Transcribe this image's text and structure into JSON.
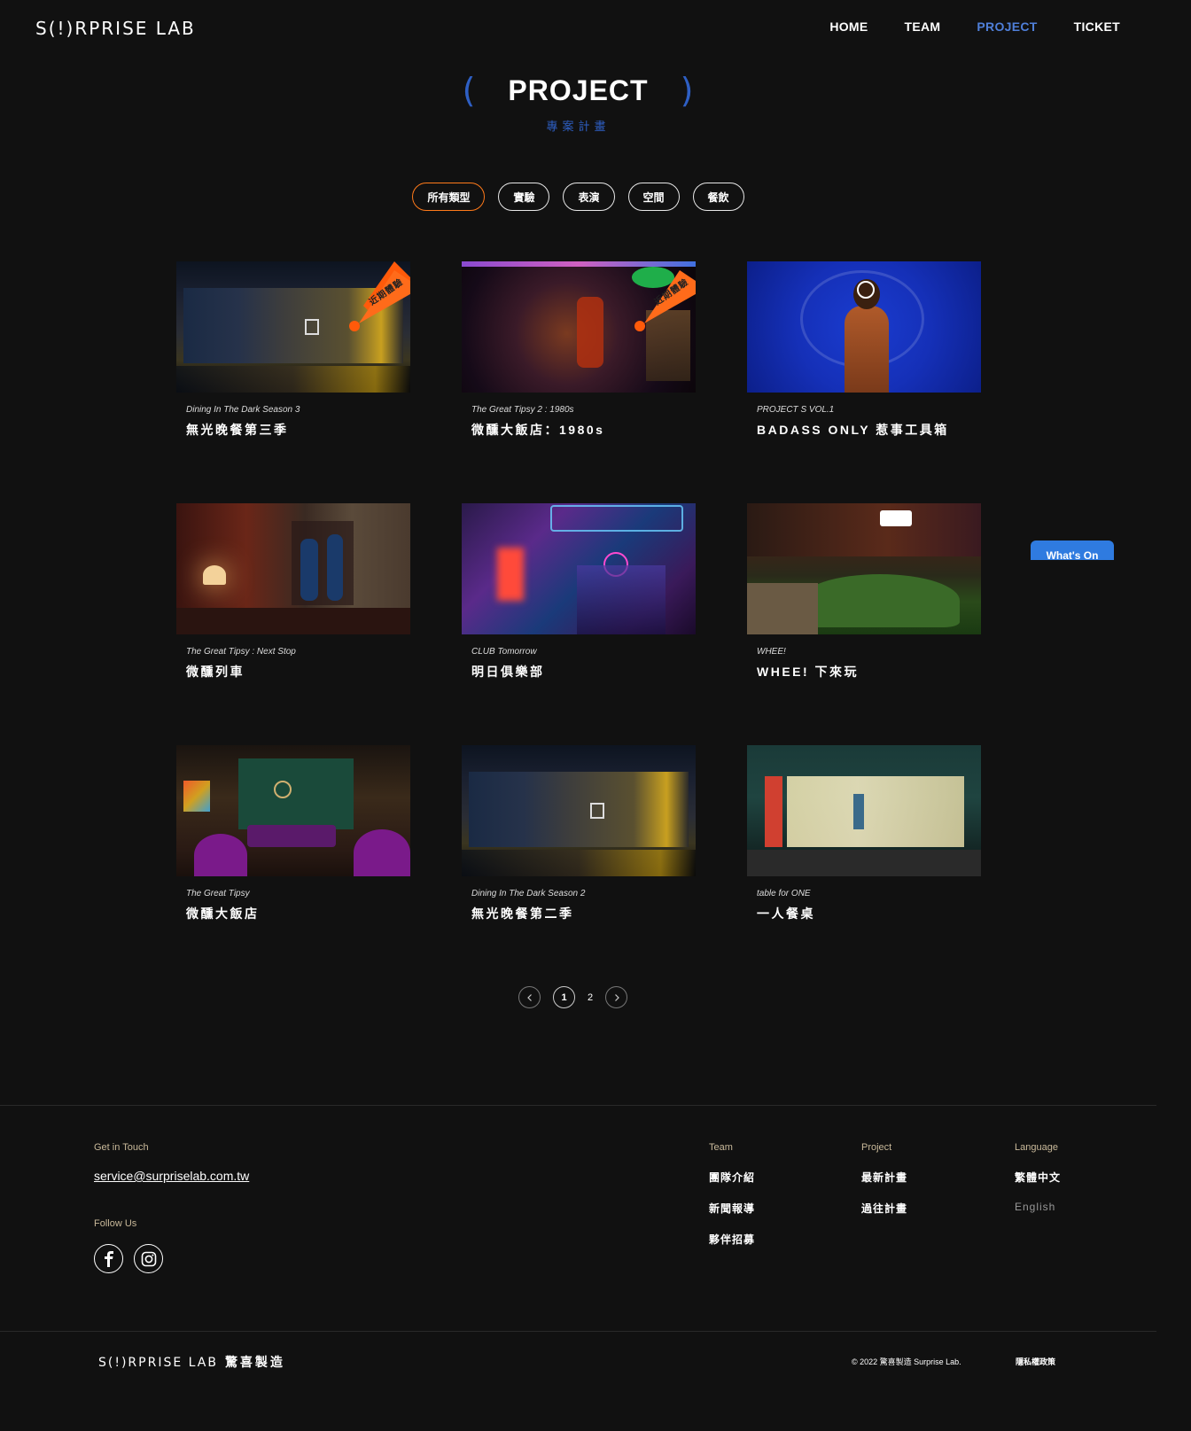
{
  "header": {
    "logo": "S(!)RPRISE LAB",
    "nav": [
      "HOME",
      "TEAM",
      "PROJECT",
      "TICKET"
    ]
  },
  "title": {
    "main": "PROJECT",
    "sub": "專案計畫"
  },
  "filters": [
    "所有類型",
    "實驗",
    "表演",
    "空間",
    "餐飲"
  ],
  "projects": [
    {
      "en": "Dining In The Dark Season 3",
      "zh": "無光晚餐第三季",
      "badge": "近期體驗"
    },
    {
      "en": "The Great Tipsy 2 : 1980s",
      "zh": "微醺大飯店：1980s",
      "badge": "近期體驗"
    },
    {
      "en": "PROJECT S VOL.1",
      "zh": "BADASS ONLY 惹事工具箱"
    },
    {
      "en": "The Great Tipsy : Next Stop",
      "zh": "微醺列車"
    },
    {
      "en": "CLUB Tomorrow",
      "zh": "明日俱樂部"
    },
    {
      "en": "WHEE!",
      "zh": "WHEE! 下來玩"
    },
    {
      "en": "The Great Tipsy",
      "zh": "微醺大飯店"
    },
    {
      "en": "Dining In The Dark Season 2",
      "zh": "無光晚餐第二季"
    },
    {
      "en": "table for ONE",
      "zh": "一人餐桌"
    }
  ],
  "whats_on": "What's On",
  "pagination": {
    "pages": [
      "1",
      "2"
    ],
    "current": "1"
  },
  "footer": {
    "get_in_touch": "Get in Touch",
    "email": "service@surpriselab.com.tw",
    "follow_us": "Follow Us",
    "team_label": "Team",
    "team_links": [
      "團隊介紹",
      "新聞報導",
      "夥伴招募"
    ],
    "project_label": "Project",
    "project_links": [
      "最新計畫",
      "過往計畫"
    ],
    "language_label": "Language",
    "languages": [
      "繁體中文",
      "English"
    ],
    "bottom_logo": "S(!)RPRISE LAB",
    "bottom_logo_zh": "驚喜製造",
    "copyright": "© 2022 驚喜製造 Surprise Lab.",
    "privacy": "隱私權政策"
  },
  "colors": {
    "accent": "#4f7fd9",
    "brand_blue": "#2e5fc4",
    "active_filter": "#ff7a1a",
    "badge": "#ff5a0a"
  }
}
